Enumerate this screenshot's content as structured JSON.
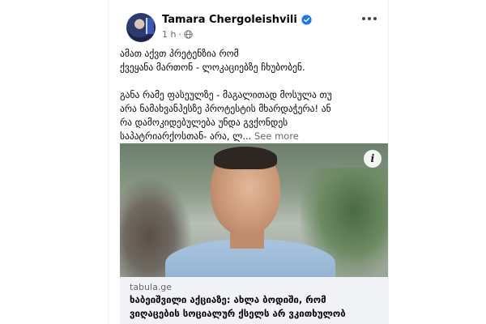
{
  "post": {
    "author": "Tamara Chergoleishvili",
    "time": "1 h",
    "text_lines": [
      "ამათ აქვთ პრეტენზია რომ",
      "ქვეყანა მართონ - ლოკაციებზე ჩხუბობენ.",
      "",
      "განა რამე ფასეულზე - მაგალითად მოსულა თუ",
      "არა ნამახვანჰესზე პროტესტის მხარდაჭერა!  ან",
      "რა დამოკიდებულება უნდა გვქონდეს",
      "საპატრიარქოსთან- არა, ლ..."
    ],
    "see_more": "See more"
  },
  "link_preview": {
    "domain": "tabula.ge",
    "title_lines": [
      "ხაბეიშვილი აქციაზე: ახლა ბოდიში, რომ",
      "ვიღაცების სოციალურ ქსელს არ ვკითხულობ"
    ]
  },
  "icons": {
    "verified": "verified-badge-icon",
    "globe": "globe-icon",
    "more": "more-options-icon",
    "info": "info-icon"
  },
  "colors": {
    "verified": "#1877f2",
    "secondary_text": "#65676b",
    "link_meta_bg": "#f0f2f5"
  }
}
